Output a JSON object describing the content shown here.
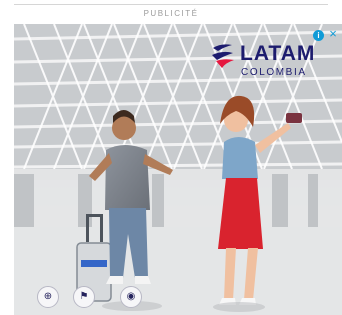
{
  "ad_slot": {
    "label": "PUBLICITÉ"
  },
  "ad": {
    "brand_name": "LATAM",
    "brand_subtitle": "COLOMBIA",
    "adchoices_icon": "i",
    "close_icon": "×",
    "colors": {
      "brand": "#1d1c6e",
      "accent": "#e5173f",
      "adchoices": "#0f9bd7"
    },
    "bottom_icons": [
      "globe-icon",
      "flag-icon",
      "logo-icon"
    ]
  }
}
